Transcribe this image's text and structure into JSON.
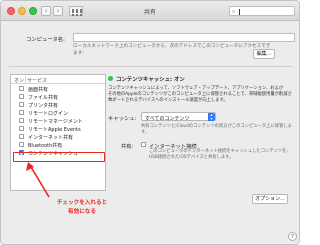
{
  "window": {
    "title": "共有"
  },
  "toolbar": {
    "back_icon": "chevron-left-icon",
    "forward_icon": "chevron-right-icon",
    "grid_icon": "grid-icon"
  },
  "search": {
    "placeholder": "",
    "icon": "search-icon"
  },
  "computer": {
    "label": "コンピュータ名:",
    "value": "",
    "help_line1": "ローカルネットワーク上のコンピュータから、次のアドレスでこのコンピュータにアクセスでき",
    "help_line2": "ます:",
    "edit_button": "編集..."
  },
  "services": {
    "header_on": "オン",
    "header_service": "サービス",
    "items": [
      {
        "label": "画面共有",
        "checked": false
      },
      {
        "label": "ファイル共有",
        "checked": false
      },
      {
        "label": "プリンタ共有",
        "checked": false
      },
      {
        "label": "リモートログイン",
        "checked": false
      },
      {
        "label": "リモートマネージメント",
        "checked": false
      },
      {
        "label": "リモートApple Events",
        "checked": false
      },
      {
        "label": "インターネット共有",
        "checked": false
      },
      {
        "label": "Bluetooth共有",
        "checked": false
      },
      {
        "label": "コンテンツキャッシュ",
        "checked": true
      }
    ]
  },
  "detail": {
    "status": "コンテンツキャッシュ: オン",
    "status_color": "#30c247",
    "desc1": "コンテンツキャッシュによって、ソフトウェア・アップデート、アプリケーション、および",
    "desc2": "その他のAppleのコンテンツがこのコンピュータ上に保管されることで、帯域幅使用量が削減され、",
    "desc3": "サポートされるデバイスへのインストール速度が向上します。",
    "cache_label": "キャッシュ:",
    "cache_value": "すべてのコンテンツ",
    "cache_note1": "共有コンテンツとiCloudのコンテンツの両方がこのコンピュータ上に保管します。",
    "share_label": "共有:",
    "share_checkbox": "インターネット接続",
    "share_note1": "このコンピュータのインターネット接続をキャッシュしたコンテンツを、",
    "share_note2": "USB接続されたiOSデバイスと共有します。",
    "options_button": "オプション..."
  },
  "annotation": {
    "line1": "チェックを入れると",
    "line2": "有効になる",
    "color": "#e8271e"
  },
  "help_button": "?"
}
